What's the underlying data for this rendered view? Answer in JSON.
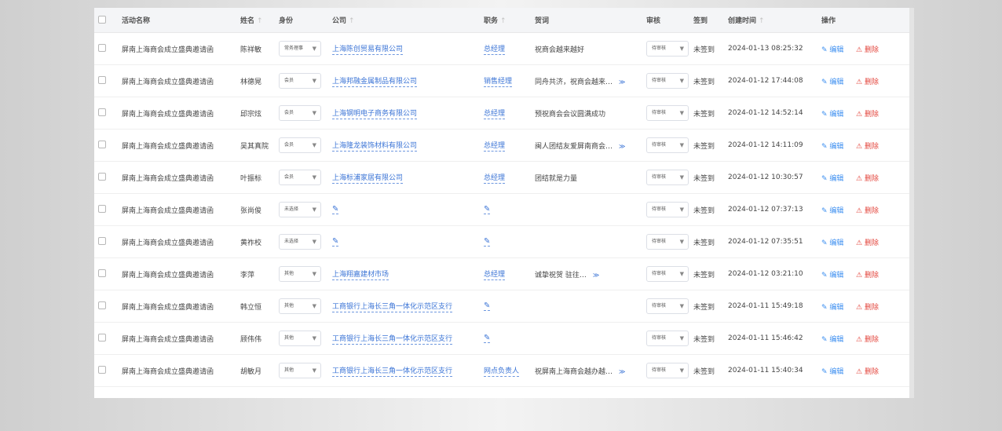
{
  "colors": {
    "accent": "#3b74d6",
    "danger": "#e3453c"
  },
  "headers": {
    "activity": "活动名称",
    "name": "姓名",
    "identity": "身份",
    "company": "公司",
    "position": "职务",
    "message": "贺词",
    "review": "审核",
    "signin": "签到",
    "created": "创建时间",
    "actions": "操作",
    "sort_icon": "↑"
  },
  "action_labels": {
    "edit": "编辑",
    "delete": "删除",
    "edit_icon": "pencil-icon",
    "delete_icon": "warning-triangle-icon"
  },
  "rows": [
    {
      "activity": "屏南上海商会成立盛典邀请函",
      "name": "陈祥敏",
      "identity": "常务理事",
      "company": "上海陈创贸易有限公司",
      "position": "总经理",
      "message": "祝商会越来越好",
      "expand": "",
      "review": "待审核",
      "signin": "未签到",
      "created": "2024-01-13 08:25:32"
    },
    {
      "activity": "屏南上海商会成立盛典邀请函",
      "name": "林德晃",
      "identity": "会员",
      "company": "上海邦融金属制品有限公司",
      "position": "销售经理",
      "message": "同舟共济，祝商会越来…",
      "expand": "≫",
      "review": "待审核",
      "signin": "未签到",
      "created": "2024-01-12 17:44:08"
    },
    {
      "activity": "屏南上海商会成立盛典邀请函",
      "name": "邱宗炫",
      "identity": "会员",
      "company": "上海钢明电子商务有限公司",
      "position": "总经理",
      "message": "预祝商会会议圆满成功",
      "expand": "",
      "review": "待审核",
      "signin": "未签到",
      "created": "2024-01-12 14:52:14"
    },
    {
      "activity": "屏南上海商会成立盛典邀请函",
      "name": "吴其真院",
      "identity": "会员",
      "company": "上海隆龙装饰材料有限公司",
      "position": "总经理",
      "message": "闽人团结友爱屏南商会…",
      "expand": "≫",
      "review": "待审核",
      "signin": "未签到",
      "created": "2024-01-12 14:11:09"
    },
    {
      "activity": "屏南上海商会成立盛典邀请函",
      "name": "叶振标",
      "identity": "会员",
      "company": "上海标浦家居有限公司",
      "position": "总经理",
      "message": "团结就是力量",
      "expand": "",
      "review": "待审核",
      "signin": "未签到",
      "created": "2024-01-12 10:30:57"
    },
    {
      "activity": "屏南上海商会成立盛典邀请函",
      "name": "张尚俊",
      "identity": "未选择",
      "company": "",
      "position": "",
      "message": "",
      "expand": "",
      "review": "待审核",
      "signin": "未签到",
      "created": "2024-01-12 07:37:13"
    },
    {
      "activity": "屏南上海商会成立盛典邀请函",
      "name": "黄祚校",
      "identity": "未选择",
      "company": "",
      "position": "",
      "message": "",
      "expand": "",
      "review": "待审核",
      "signin": "未签到",
      "created": "2024-01-12 07:35:51"
    },
    {
      "activity": "屏南上海商会成立盛典邀请函",
      "name": "李萍",
      "identity": "其他",
      "company": "上海翔嘉建材市场",
      "position": "总经理",
      "message": "诚挚祝贺 驻往…",
      "expand": "≫",
      "review": "待审核",
      "signin": "未签到",
      "created": "2024-01-12 03:21:10"
    },
    {
      "activity": "屏南上海商会成立盛典邀请函",
      "name": "韩立恒",
      "identity": "其他",
      "company": "工商银行上海长三角一体化示范区支行",
      "position": "",
      "message": "",
      "expand": "",
      "review": "待审核",
      "signin": "未签到",
      "created": "2024-01-11 15:49:18"
    },
    {
      "activity": "屏南上海商会成立盛典邀请函",
      "name": "顾伟伟",
      "identity": "其他",
      "company": "工商银行上海长三角一体化示范区支行",
      "position": "",
      "message": "",
      "expand": "",
      "review": "待审核",
      "signin": "未签到",
      "created": "2024-01-11 15:46:42"
    },
    {
      "activity": "屏南上海商会成立盛典邀请函",
      "name": "胡敏月",
      "identity": "其他",
      "company": "工商银行上海长三角一体化示范区支行",
      "position": "网点负责人",
      "message": "祝屏南上海商会越办越…",
      "expand": "≫",
      "review": "待审核",
      "signin": "未签到",
      "created": "2024-01-11 15:40:34"
    }
  ]
}
